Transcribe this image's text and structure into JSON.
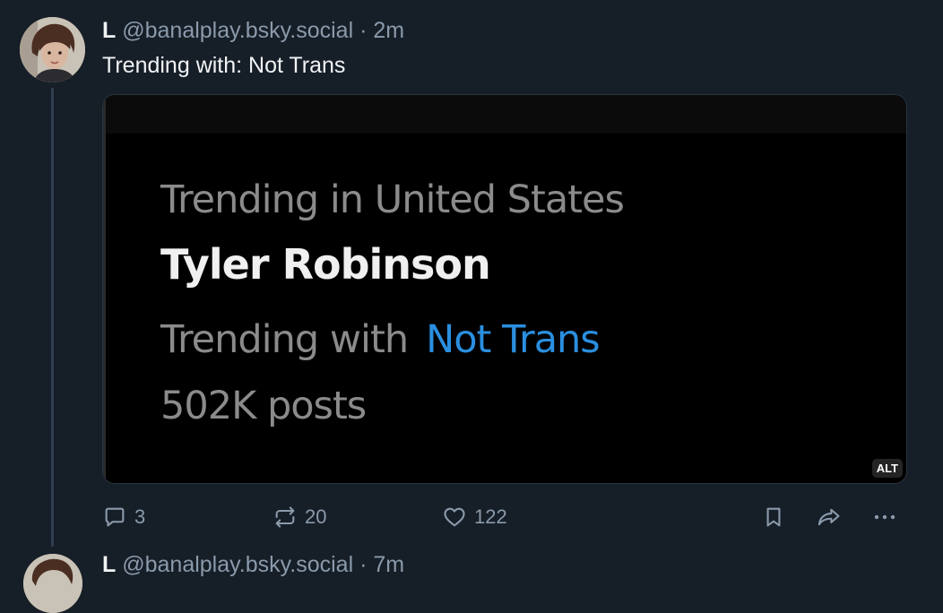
{
  "post": {
    "author_name": "L",
    "handle": "@banalplay.bsky.social",
    "separator": "·",
    "timestamp": "2m",
    "text": "Trending with: Not Trans",
    "embed": {
      "context": "Trending in United States",
      "topic": "Tyler Robinson",
      "trending_with_label": "Trending with",
      "trending_with_value": "Not Trans",
      "post_count": "502K posts",
      "alt_badge": "ALT"
    },
    "actions": {
      "reply_icon": "reply-icon",
      "reply_count": "3",
      "repost_icon": "repost-icon",
      "repost_count": "20",
      "like_icon": "heart-icon",
      "like_count": "122",
      "bookmark_icon": "bookmark-icon",
      "share_icon": "share-icon",
      "more_icon": "more-icon"
    }
  },
  "next_post": {
    "author_name": "L",
    "handle": "@banalplay.bsky.social",
    "separator": "·",
    "timestamp": "7m"
  },
  "colors": {
    "background": "#161e27",
    "muted_text": "#8a9aab",
    "link_blue": "#2a8fe0",
    "thread_line": "#2e4052"
  }
}
